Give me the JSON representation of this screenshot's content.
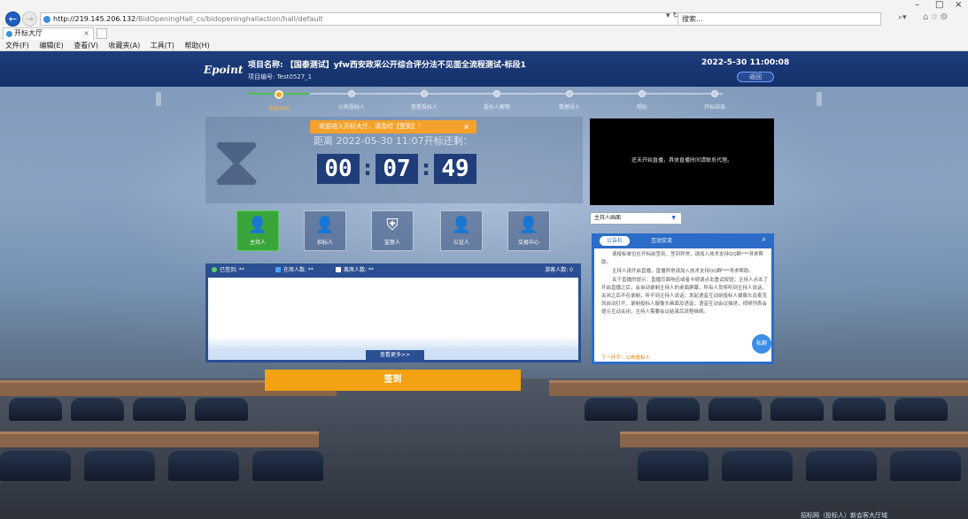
{
  "browser": {
    "url_host": "http://219.145.206.132",
    "url_path": "/BidOpeningHall_cs/bidopeninghallaction/hall/default",
    "search_placeholder": "搜索...",
    "tab_title": "开标大厅",
    "menu": [
      "文件(F)",
      "编辑(E)",
      "查看(V)",
      "收藏夹(A)",
      "工具(T)",
      "帮助(H)"
    ]
  },
  "header": {
    "logo": "Epoint",
    "project_name": "项目名称: 【国泰测试】yfw西安政采公开综合评分法不见面全流程测试-标段1",
    "project_no": "项目编号: Test0527_1",
    "datetime": "2022-5-30   11:00:08",
    "back_label": "返回"
  },
  "steps": [
    {
      "label": "等待开标",
      "active": true
    },
    {
      "label": "公布投标人",
      "active": false
    },
    {
      "label": "查看投标人",
      "active": false
    },
    {
      "label": "投标人解密",
      "active": false
    },
    {
      "label": "数据导入",
      "active": false
    },
    {
      "label": "唱标",
      "active": false
    },
    {
      "label": "开标结束",
      "active": false
    }
  ],
  "countdown": {
    "notice": "欢迎进入开标大厅，请及时【签到】！",
    "notice_close": "×",
    "subtitle": "距离 2022-05-30 11:07开标还剩：",
    "hours": "00",
    "minutes": "07",
    "seconds": "49"
  },
  "live": {
    "message": "还未开始直播，具体直播时间请联系代理。"
  },
  "roles": [
    {
      "label": "主持人",
      "active": true
    },
    {
      "label": "招标人",
      "active": false
    },
    {
      "label": "监督人",
      "active": false
    },
    {
      "label": "公证人",
      "active": false
    },
    {
      "label": "交易中心",
      "active": false
    }
  ],
  "host_select": {
    "value": "主持人画面"
  },
  "signin": {
    "signed": "已签到: **",
    "online": "在席人数: **",
    "offline": "离席人数: **",
    "visitors": "游客人数: 0",
    "more_label": "查看更多>>"
  },
  "chat": {
    "tab_notice": "公告栏",
    "tab_interact": "互动交流",
    "paragraphs": [
      "请投标单位在开标前签到，签到异常，请加入技术支持QQ群***寻求帮助。",
      "主持人请开启直播，直播异常请加入技术支持QQ群***寻求帮助。",
      "关于直播的提示：直播页面响应或者卡顿请点击重试按钮；主持人点击了开启直播之后，会自动录制主持人的桌面屏幕，所有人员将听到主持人说话，关闭之后不在录制，听不到主持人说话；发起语音互动前投标人摄像头及麦克风自动打开，录制投标人摄像头画面及语音；语音互动会议描述，视频列表会提示互动关闭，主持人需要会议结束后流程继续。"
    ],
    "next_step": "下一环节：公布投标人",
    "private_label": "私聊"
  },
  "sign_button": "签到",
  "bottom_tag": "招标网（投标人）新会客大厅域"
}
